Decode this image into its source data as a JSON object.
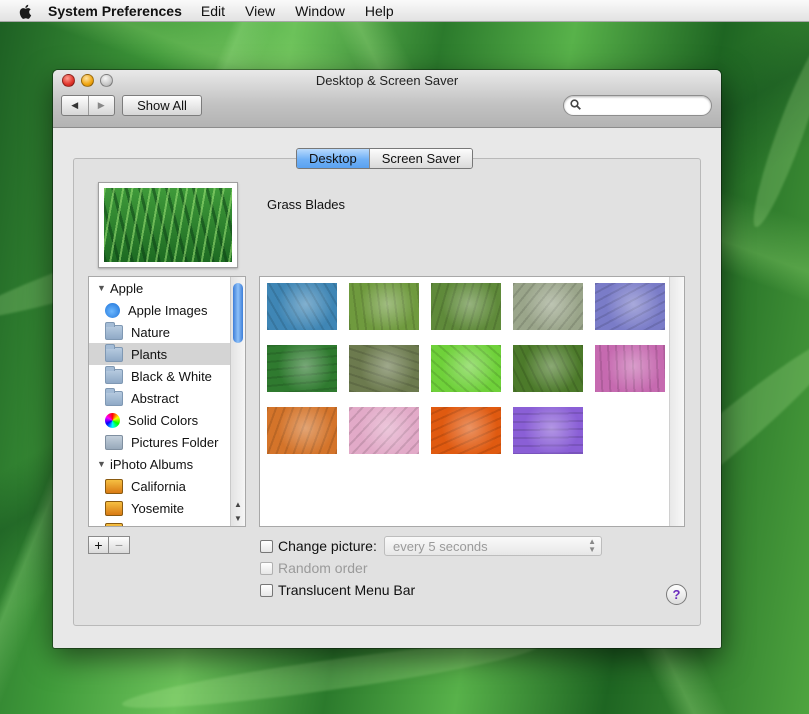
{
  "menubar": {
    "apple_icon": "apple-icon",
    "app_name": "System Preferences",
    "items": [
      "Edit",
      "View",
      "Window",
      "Help"
    ]
  },
  "window": {
    "title": "Desktop & Screen Saver",
    "back_icon": "back-arrow-icon",
    "forward_icon": "forward-arrow-icon",
    "show_all_label": "Show All",
    "search": {
      "value": "",
      "placeholder": "",
      "icon": "magnifier-icon"
    }
  },
  "tabs": [
    {
      "label": "Desktop",
      "selected": true
    },
    {
      "label": "Screen Saver",
      "selected": false
    }
  ],
  "current_picture": {
    "name": "Grass Blades"
  },
  "source_list": {
    "groups": [
      {
        "label": "Apple",
        "expanded": true,
        "items": [
          {
            "label": "Apple Images",
            "icon": "apple-logo-icon"
          },
          {
            "label": "Nature",
            "icon": "folder-icon"
          },
          {
            "label": "Plants",
            "icon": "folder-icon",
            "selected": true
          },
          {
            "label": "Black & White",
            "icon": "folder-icon"
          },
          {
            "label": "Abstract",
            "icon": "folder-icon"
          },
          {
            "label": "Solid Colors",
            "icon": "color-wheel-icon"
          },
          {
            "label": "Pictures Folder",
            "icon": "pictures-folder-icon"
          }
        ]
      },
      {
        "label": "iPhoto Albums",
        "expanded": true,
        "items": [
          {
            "label": "California",
            "icon": "album-icon"
          },
          {
            "label": "Yosemite",
            "icon": "album-icon"
          }
        ]
      }
    ],
    "add_label": "+",
    "remove_label": "−"
  },
  "images": [
    {
      "name": "agave",
      "color": "#3f86b5"
    },
    {
      "name": "bamboo",
      "color": "#6f9a3e"
    },
    {
      "name": "daisies",
      "color": "#5f8a3a"
    },
    {
      "name": "dandelion",
      "color": "#9aa58a"
    },
    {
      "name": "purple-dandelion",
      "color": "#7a7cc8"
    },
    {
      "name": "grass-blades",
      "color": "#2f7a2f"
    },
    {
      "name": "meadow",
      "color": "#6c7a4e"
    },
    {
      "name": "green-leaf",
      "color": "#6fd13a"
    },
    {
      "name": "moss",
      "color": "#4c7a2a"
    },
    {
      "name": "lotus",
      "color": "#c66ab0"
    },
    {
      "name": "maple-leaves",
      "color": "#d4742a"
    },
    {
      "name": "pink-flower",
      "color": "#e2aac8"
    },
    {
      "name": "rose",
      "color": "#e05a10"
    },
    {
      "name": "purple-petals",
      "color": "#8a5fd6"
    }
  ],
  "options": {
    "change_picture_label": "Change picture:",
    "change_picture_checked": false,
    "interval_value": "every 5 seconds",
    "random_order_label": "Random order",
    "random_order_enabled": false,
    "translucent_label": "Translucent Menu Bar",
    "translucent_checked": false,
    "help_label": "?"
  }
}
